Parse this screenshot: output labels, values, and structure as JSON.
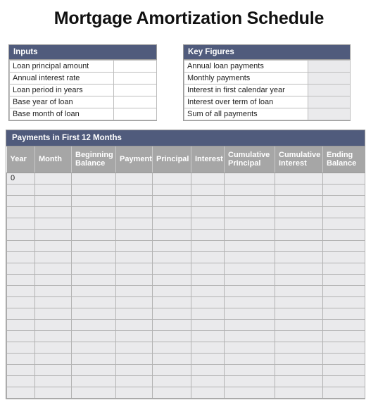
{
  "page": {
    "title": "Mortgage Amortization Schedule"
  },
  "theme": {
    "header_blue": "#505b7c",
    "column_header_gray": "#a6a6a6",
    "cell_fill_gray": "#eaeaec",
    "grid_line": "#b3b3b3",
    "page_background": "#ffffff",
    "text_color": "#1f1f1f"
  },
  "inputs": {
    "title": "Inputs",
    "rows": [
      {
        "label": "Loan principal amount",
        "value": ""
      },
      {
        "label": "Annual interest rate",
        "value": ""
      },
      {
        "label": "Loan period in years",
        "value": ""
      },
      {
        "label": "Base year of loan",
        "value": ""
      },
      {
        "label": "Base month of loan",
        "value": ""
      }
    ]
  },
  "key_figures": {
    "title": "Key Figures",
    "rows": [
      {
        "label": "Annual loan payments",
        "value": ""
      },
      {
        "label": "Monthly payments",
        "value": ""
      },
      {
        "label": "Interest in first calendar year",
        "value": ""
      },
      {
        "label": "Interest over term of loan",
        "value": ""
      },
      {
        "label": "Sum of all payments",
        "value": ""
      }
    ]
  },
  "schedule": {
    "title": "Payments in First 12 Months",
    "columns": [
      "Year",
      "Month",
      "Beginning Balance",
      "Payment",
      "Principal",
      "Interest",
      "Cumulative Principal",
      "Cumulative Interest",
      "Ending Balance"
    ],
    "rows": [
      [
        "0",
        "",
        "",
        "",
        "",
        "",
        "",
        "",
        ""
      ],
      [
        "",
        "",
        "",
        "",
        "",
        "",
        "",
        "",
        ""
      ],
      [
        "",
        "",
        "",
        "",
        "",
        "",
        "",
        "",
        ""
      ],
      [
        "",
        "",
        "",
        "",
        "",
        "",
        "",
        "",
        ""
      ],
      [
        "",
        "",
        "",
        "",
        "",
        "",
        "",
        "",
        ""
      ],
      [
        "",
        "",
        "",
        "",
        "",
        "",
        "",
        "",
        ""
      ],
      [
        "",
        "",
        "",
        "",
        "",
        "",
        "",
        "",
        ""
      ],
      [
        "",
        "",
        "",
        "",
        "",
        "",
        "",
        "",
        ""
      ],
      [
        "",
        "",
        "",
        "",
        "",
        "",
        "",
        "",
        ""
      ],
      [
        "",
        "",
        "",
        "",
        "",
        "",
        "",
        "",
        ""
      ],
      [
        "",
        "",
        "",
        "",
        "",
        "",
        "",
        "",
        ""
      ],
      [
        "",
        "",
        "",
        "",
        "",
        "",
        "",
        "",
        ""
      ],
      [
        "",
        "",
        "",
        "",
        "",
        "",
        "",
        "",
        ""
      ],
      [
        "",
        "",
        "",
        "",
        "",
        "",
        "",
        "",
        ""
      ],
      [
        "",
        "",
        "",
        "",
        "",
        "",
        "",
        "",
        ""
      ],
      [
        "",
        "",
        "",
        "",
        "",
        "",
        "",
        "",
        ""
      ],
      [
        "",
        "",
        "",
        "",
        "",
        "",
        "",
        "",
        ""
      ],
      [
        "",
        "",
        "",
        "",
        "",
        "",
        "",
        "",
        ""
      ],
      [
        "",
        "",
        "",
        "",
        "",
        "",
        "",
        "",
        ""
      ],
      [
        "",
        "",
        "",
        "",
        "",
        "",
        "",
        "",
        ""
      ]
    ]
  }
}
